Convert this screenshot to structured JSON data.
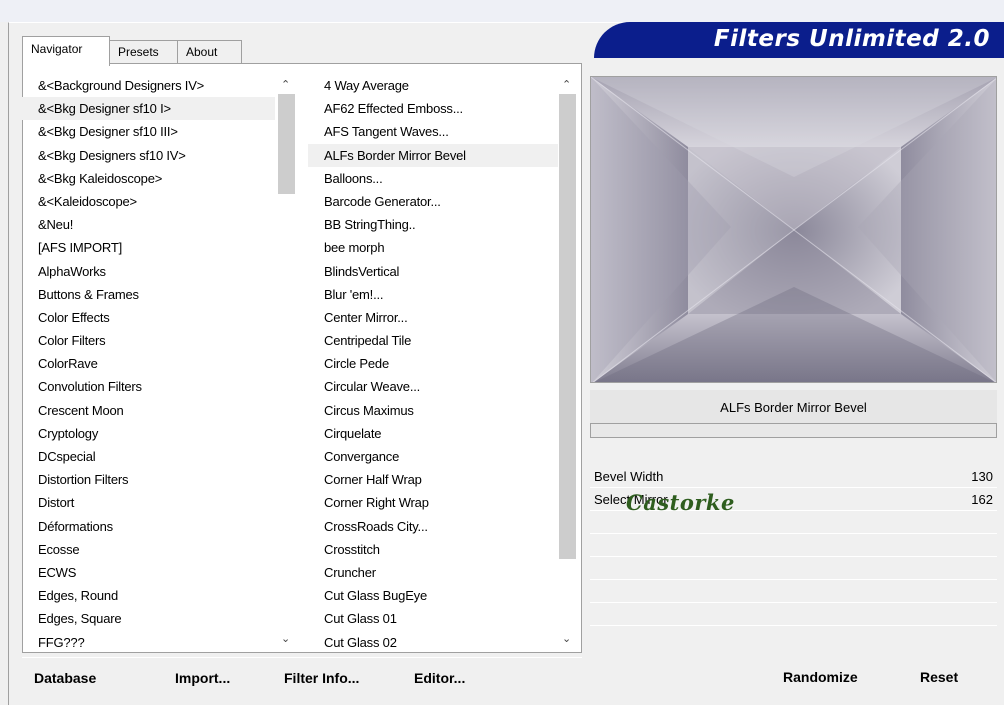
{
  "window": {
    "brand": "Filters Unlimited 2.0"
  },
  "tabs": [
    {
      "label": "Navigator",
      "active": true
    },
    {
      "label": "Presets",
      "active": false
    },
    {
      "label": "About",
      "active": false
    }
  ],
  "categories": {
    "items": [
      "&<Background Designers IV>",
      "&<Bkg Designer sf10 I>",
      "&<Bkg Designer sf10 III>",
      "&<Bkg Designers sf10 IV>",
      "&<Bkg Kaleidoscope>",
      "&<Kaleidoscope>",
      "&Neu!",
      "[AFS IMPORT]",
      "AlphaWorks",
      "Buttons & Frames",
      "Color Effects",
      "Color Filters",
      "ColorRave",
      "Convolution Filters",
      "Crescent Moon",
      "Cryptology",
      "DCspecial",
      "Distortion Filters",
      "Distort",
      "Déformations",
      "Ecosse",
      "ECWS",
      "Edges, Round",
      "Edges, Square",
      "FFG???"
    ],
    "selected_index": 1
  },
  "filters": {
    "items": [
      "4 Way Average",
      "AF62 Effected Emboss...",
      "AFS Tangent Waves...",
      "ALFs Border Mirror Bevel",
      "Balloons...",
      "Barcode Generator...",
      "BB StringThing..",
      "bee morph",
      "BlindsVertical",
      "Blur 'em!...",
      "Center Mirror...",
      "Centripedal Tile",
      "Circle Pede",
      "Circular Weave...",
      "Circus Maximus",
      "Cirquelate",
      "Convergance",
      "Corner Half Wrap",
      "Corner Right Wrap",
      "CrossRoads City...",
      "Crosstitch",
      "Cruncher",
      "Cut Glass  BugEye",
      "Cut Glass 01",
      "Cut Glass 02"
    ],
    "selected_index": 3
  },
  "preview": {
    "current_filter": "ALFs Border Mirror Bevel",
    "progress": 0,
    "colors": {
      "light": "#c9c6cf",
      "mid": "#9d9aa8",
      "dark": "#6f6c80"
    }
  },
  "params": [
    {
      "label": "Bevel Width",
      "value": "130"
    },
    {
      "label": "Select Mirror",
      "value": "162"
    }
  ],
  "watermark": "Castorke",
  "buttons": {
    "database": "Database",
    "import": "Import...",
    "filter_info": "Filter Info...",
    "editor": "Editor...",
    "randomize": "Randomize",
    "reset": "Reset"
  }
}
